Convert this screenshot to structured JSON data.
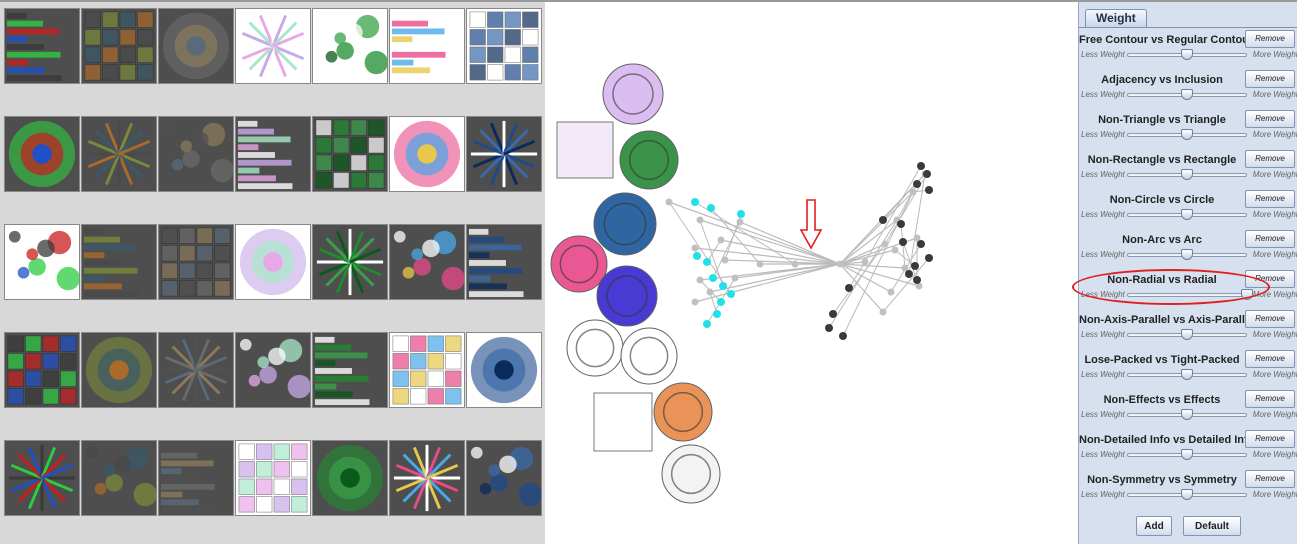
{
  "panel": {
    "tab_label": "Weight",
    "less_label": "Less Weight",
    "more_label": "More Weight",
    "remove_label": "Remove",
    "add_label": "Add",
    "default_label": "Default",
    "criteria": [
      {
        "title": "Free Contour  vs  Regular Contour",
        "weight": 0.5
      },
      {
        "title": "Adjacency  vs  Inclusion",
        "weight": 0.5
      },
      {
        "title": "Non-Triangle  vs  Triangle",
        "weight": 0.5
      },
      {
        "title": "Non-Rectangle  vs  Rectangle",
        "weight": 0.5
      },
      {
        "title": "Non-Circle  vs  Circle",
        "weight": 0.5
      },
      {
        "title": "Non-Arc  vs  Arc",
        "weight": 0.5
      },
      {
        "title": "Non-Radial  vs  Radial",
        "weight": 1.0,
        "highlighted": true
      },
      {
        "title": "Non-Axis-Parallel  vs  Axis-Parallel",
        "weight": 0.5
      },
      {
        "title": "Lose-Packed  vs  Tight-Packed",
        "weight": 0.5
      },
      {
        "title": "Non-Effects  vs  Effects",
        "weight": 0.5
      },
      {
        "title": "Non-Detailed Info  vs  Detailed Info",
        "weight": 0.5
      },
      {
        "title": "Non-Symmetry  vs  Symmetry",
        "weight": 0.5
      }
    ]
  },
  "gallery": {
    "thumbnails": [
      "icicle-bars",
      "treemap-grid",
      "treemap-dense",
      "sunburst-rings-purple",
      "radial-tree-green",
      "circle-packing-clusters",
      "radial-fan-blue",
      "treemap-colorful",
      "circle-sketch",
      "bar-sketch",
      "grid-lines",
      "dark-treemap",
      "sunburst-pie-colorful",
      "radial-wedge-blue",
      "sunburst-blue-magenta",
      "treemap-yellow-green",
      "triangle-dark",
      "spiral-bw",
      "box-diagram",
      "hilbert-map",
      "line-tree-map",
      "circle-packing-dark",
      "dark-network",
      "treemap-blue",
      "treemap-brown",
      "voronoi-treemap",
      "circle-nesting",
      "radial-box-blue",
      "bubble-dark",
      "triangle-pyramid",
      "radial-sunburst-green",
      "flower-radial",
      "organic-dark",
      "green-circles",
      "tan-blob"
    ]
  },
  "canvas": {
    "arrow_color": "#e02020",
    "highlight_color": "#e02020",
    "node_colors": {
      "cyan": "#22e0e8",
      "gray": "#c0c0c0",
      "dark": "#3a3a3a"
    }
  }
}
